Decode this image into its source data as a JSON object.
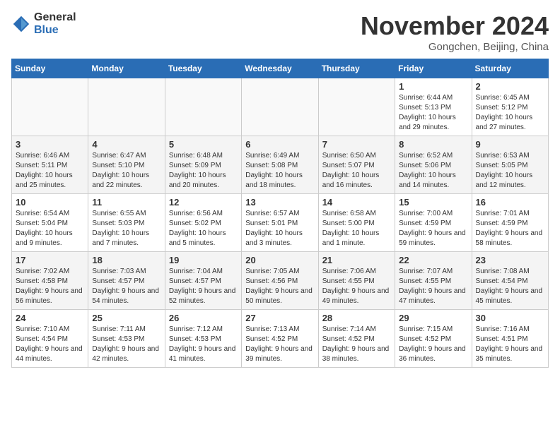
{
  "header": {
    "logo_general": "General",
    "logo_blue": "Blue",
    "month_title": "November 2024",
    "location": "Gongchen, Beijing, China"
  },
  "days_of_week": [
    "Sunday",
    "Monday",
    "Tuesday",
    "Wednesday",
    "Thursday",
    "Friday",
    "Saturday"
  ],
  "weeks": [
    {
      "shade": "white",
      "days": [
        {
          "num": "",
          "empty": true
        },
        {
          "num": "",
          "empty": true
        },
        {
          "num": "",
          "empty": true
        },
        {
          "num": "",
          "empty": true
        },
        {
          "num": "",
          "empty": true
        },
        {
          "num": "1",
          "sunrise": "Sunrise: 6:44 AM",
          "sunset": "Sunset: 5:13 PM",
          "daylight": "Daylight: 10 hours and 29 minutes."
        },
        {
          "num": "2",
          "sunrise": "Sunrise: 6:45 AM",
          "sunset": "Sunset: 5:12 PM",
          "daylight": "Daylight: 10 hours and 27 minutes."
        }
      ]
    },
    {
      "shade": "gray",
      "days": [
        {
          "num": "3",
          "sunrise": "Sunrise: 6:46 AM",
          "sunset": "Sunset: 5:11 PM",
          "daylight": "Daylight: 10 hours and 25 minutes."
        },
        {
          "num": "4",
          "sunrise": "Sunrise: 6:47 AM",
          "sunset": "Sunset: 5:10 PM",
          "daylight": "Daylight: 10 hours and 22 minutes."
        },
        {
          "num": "5",
          "sunrise": "Sunrise: 6:48 AM",
          "sunset": "Sunset: 5:09 PM",
          "daylight": "Daylight: 10 hours and 20 minutes."
        },
        {
          "num": "6",
          "sunrise": "Sunrise: 6:49 AM",
          "sunset": "Sunset: 5:08 PM",
          "daylight": "Daylight: 10 hours and 18 minutes."
        },
        {
          "num": "7",
          "sunrise": "Sunrise: 6:50 AM",
          "sunset": "Sunset: 5:07 PM",
          "daylight": "Daylight: 10 hours and 16 minutes."
        },
        {
          "num": "8",
          "sunrise": "Sunrise: 6:52 AM",
          "sunset": "Sunset: 5:06 PM",
          "daylight": "Daylight: 10 hours and 14 minutes."
        },
        {
          "num": "9",
          "sunrise": "Sunrise: 6:53 AM",
          "sunset": "Sunset: 5:05 PM",
          "daylight": "Daylight: 10 hours and 12 minutes."
        }
      ]
    },
    {
      "shade": "white",
      "days": [
        {
          "num": "10",
          "sunrise": "Sunrise: 6:54 AM",
          "sunset": "Sunset: 5:04 PM",
          "daylight": "Daylight: 10 hours and 9 minutes."
        },
        {
          "num": "11",
          "sunrise": "Sunrise: 6:55 AM",
          "sunset": "Sunset: 5:03 PM",
          "daylight": "Daylight: 10 hours and 7 minutes."
        },
        {
          "num": "12",
          "sunrise": "Sunrise: 6:56 AM",
          "sunset": "Sunset: 5:02 PM",
          "daylight": "Daylight: 10 hours and 5 minutes."
        },
        {
          "num": "13",
          "sunrise": "Sunrise: 6:57 AM",
          "sunset": "Sunset: 5:01 PM",
          "daylight": "Daylight: 10 hours and 3 minutes."
        },
        {
          "num": "14",
          "sunrise": "Sunrise: 6:58 AM",
          "sunset": "Sunset: 5:00 PM",
          "daylight": "Daylight: 10 hours and 1 minute."
        },
        {
          "num": "15",
          "sunrise": "Sunrise: 7:00 AM",
          "sunset": "Sunset: 4:59 PM",
          "daylight": "Daylight: 9 hours and 59 minutes."
        },
        {
          "num": "16",
          "sunrise": "Sunrise: 7:01 AM",
          "sunset": "Sunset: 4:59 PM",
          "daylight": "Daylight: 9 hours and 58 minutes."
        }
      ]
    },
    {
      "shade": "gray",
      "days": [
        {
          "num": "17",
          "sunrise": "Sunrise: 7:02 AM",
          "sunset": "Sunset: 4:58 PM",
          "daylight": "Daylight: 9 hours and 56 minutes."
        },
        {
          "num": "18",
          "sunrise": "Sunrise: 7:03 AM",
          "sunset": "Sunset: 4:57 PM",
          "daylight": "Daylight: 9 hours and 54 minutes."
        },
        {
          "num": "19",
          "sunrise": "Sunrise: 7:04 AM",
          "sunset": "Sunset: 4:57 PM",
          "daylight": "Daylight: 9 hours and 52 minutes."
        },
        {
          "num": "20",
          "sunrise": "Sunrise: 7:05 AM",
          "sunset": "Sunset: 4:56 PM",
          "daylight": "Daylight: 9 hours and 50 minutes."
        },
        {
          "num": "21",
          "sunrise": "Sunrise: 7:06 AM",
          "sunset": "Sunset: 4:55 PM",
          "daylight": "Daylight: 9 hours and 49 minutes."
        },
        {
          "num": "22",
          "sunrise": "Sunrise: 7:07 AM",
          "sunset": "Sunset: 4:55 PM",
          "daylight": "Daylight: 9 hours and 47 minutes."
        },
        {
          "num": "23",
          "sunrise": "Sunrise: 7:08 AM",
          "sunset": "Sunset: 4:54 PM",
          "daylight": "Daylight: 9 hours and 45 minutes."
        }
      ]
    },
    {
      "shade": "white",
      "days": [
        {
          "num": "24",
          "sunrise": "Sunrise: 7:10 AM",
          "sunset": "Sunset: 4:54 PM",
          "daylight": "Daylight: 9 hours and 44 minutes."
        },
        {
          "num": "25",
          "sunrise": "Sunrise: 7:11 AM",
          "sunset": "Sunset: 4:53 PM",
          "daylight": "Daylight: 9 hours and 42 minutes."
        },
        {
          "num": "26",
          "sunrise": "Sunrise: 7:12 AM",
          "sunset": "Sunset: 4:53 PM",
          "daylight": "Daylight: 9 hours and 41 minutes."
        },
        {
          "num": "27",
          "sunrise": "Sunrise: 7:13 AM",
          "sunset": "Sunset: 4:52 PM",
          "daylight": "Daylight: 9 hours and 39 minutes."
        },
        {
          "num": "28",
          "sunrise": "Sunrise: 7:14 AM",
          "sunset": "Sunset: 4:52 PM",
          "daylight": "Daylight: 9 hours and 38 minutes."
        },
        {
          "num": "29",
          "sunrise": "Sunrise: 7:15 AM",
          "sunset": "Sunset: 4:52 PM",
          "daylight": "Daylight: 9 hours and 36 minutes."
        },
        {
          "num": "30",
          "sunrise": "Sunrise: 7:16 AM",
          "sunset": "Sunset: 4:51 PM",
          "daylight": "Daylight: 9 hours and 35 minutes."
        }
      ]
    }
  ]
}
